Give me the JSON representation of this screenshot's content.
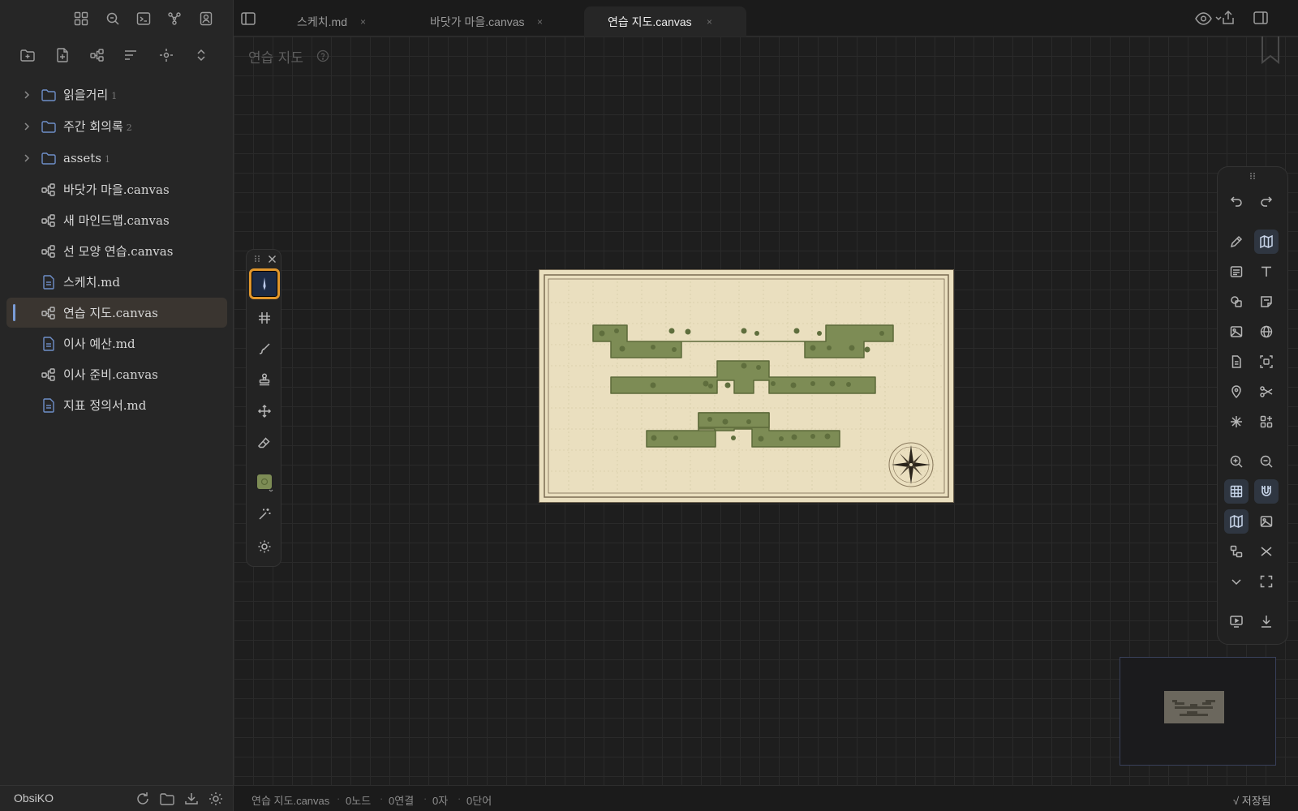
{
  "sidebar": {
    "tree": [
      {
        "label": "읽을거리",
        "count": "1",
        "type": "folder"
      },
      {
        "label": "주간 회의록",
        "count": "2",
        "type": "folder"
      },
      {
        "label": "assets",
        "count": "1",
        "type": "folder"
      },
      {
        "label": "바닷가 마을.canvas",
        "type": "canvas"
      },
      {
        "label": "새 마인드맵.canvas",
        "type": "canvas"
      },
      {
        "label": "선 모양 연습.canvas",
        "type": "canvas"
      },
      {
        "label": "스케치.md",
        "type": "md"
      },
      {
        "label": "연습 지도.canvas",
        "type": "canvas",
        "active": true
      },
      {
        "label": "이사 예산.md",
        "type": "md"
      },
      {
        "label": "이사 준비.canvas",
        "type": "canvas"
      },
      {
        "label": "지표 정의서.md",
        "type": "md"
      }
    ],
    "vault_name": "ObsiKO"
  },
  "tabs": [
    {
      "label": "스케치.md",
      "close": "×"
    },
    {
      "label": "바닷가 마을.canvas",
      "close": "×"
    },
    {
      "label": "연습 지도.canvas",
      "close": "×",
      "active": true
    }
  ],
  "canvas": {
    "title": "연습 지도",
    "map_colors": {
      "paper": "#eadfbf",
      "land": "#7d8c55",
      "land_dark": "#5c6a3a"
    }
  },
  "draw_toolbar": {
    "active_tool": "pen",
    "color_swatch": "#7d8c55"
  },
  "status": {
    "file": "연습 지도.canvas",
    "nodes": "0노드",
    "edges": "0연결",
    "chars": "0자",
    "words": "0단어",
    "saved": "√ 저장됨"
  }
}
